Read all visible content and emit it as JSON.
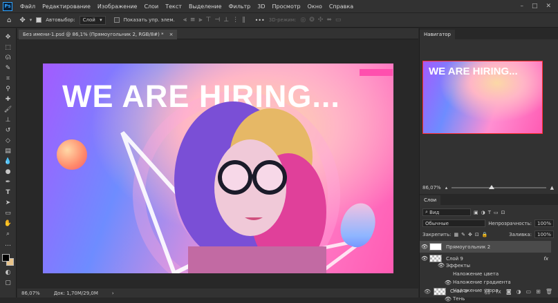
{
  "app": {
    "logo": "Ps"
  },
  "menu": [
    "Файл",
    "Редактирование",
    "Изображение",
    "Слои",
    "Текст",
    "Выделение",
    "Фильтр",
    "3D",
    "Просмотр",
    "Окно",
    "Справка"
  ],
  "options": {
    "autoselect_label": "Автовыбор:",
    "autoselect_value": "Слой",
    "show_controls_label": "Показать упр. элем.",
    "mode3d_label": "3D-режим:"
  },
  "document": {
    "tab_title": "Без имени-1.psd @ 86,1% (Прямоугольник 2, RGB/8#) *",
    "close_glyph": "×",
    "headline": "WE ARE HIRING..."
  },
  "status": {
    "zoom": "86,07%",
    "doc_info": "Док: 1,70M/29,0M"
  },
  "navigator": {
    "tab_label": "Навигатор",
    "zoom": "86,07%",
    "zoom_fraction": 0.42
  },
  "layers_panel": {
    "tab_label": "Слои",
    "filter_label": "Вид",
    "blend_mode": "Обычные",
    "opacity_label": "Непрозрачность:",
    "opacity_value": "100%",
    "lock_label": "Закрепить:",
    "fill_label": "Заливка:",
    "fill_value": "100%",
    "layers": [
      {
        "name": "Прямоугольник 2",
        "selected": true
      },
      {
        "name": "Слой 9",
        "fx": "fx"
      },
      {
        "name": "Эффекты"
      },
      {
        "name": "Наложение цвета"
      },
      {
        "name": "Наложение градиента"
      },
      {
        "name": "Наложение узора"
      },
      {
        "name": "Тень"
      },
      {
        "name": "Слой 8"
      }
    ]
  }
}
